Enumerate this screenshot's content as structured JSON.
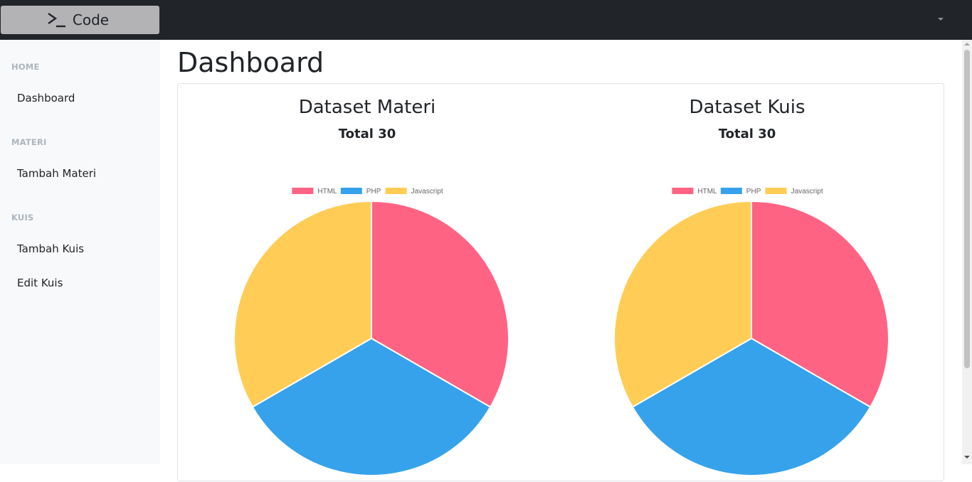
{
  "header": {
    "brand_label": "Code",
    "brand_icon": "terminal-icon"
  },
  "sidebar": {
    "sections": [
      {
        "heading": "HOME",
        "items": [
          {
            "label": "Dashboard"
          }
        ]
      },
      {
        "heading": "MATERI",
        "items": [
          {
            "label": "Tambah Materi"
          }
        ]
      },
      {
        "heading": "KUIS",
        "items": [
          {
            "label": "Tambah Kuis"
          },
          {
            "label": "Edit Kuis"
          }
        ]
      }
    ]
  },
  "main": {
    "page_title": "Dashboard"
  },
  "colors": {
    "html": "#ff6384",
    "php": "#36a2eb",
    "javascript": "#ffcd56",
    "topbar": "#212529",
    "sidebar": "#f8f9fa"
  },
  "charts": [
    {
      "title": "Dataset Materi",
      "subtitle": "Total 30"
    },
    {
      "title": "Dataset Kuis",
      "subtitle": "Total 30"
    }
  ],
  "chart_data": [
    {
      "type": "pie",
      "title": "Dataset Materi",
      "subtitle": "Total 30",
      "categories": [
        "HTML",
        "PHP",
        "Javascript"
      ],
      "values": [
        10,
        10,
        10
      ],
      "colors": [
        "#ff6384",
        "#36a2eb",
        "#ffcd56"
      ],
      "legend_position": "top"
    },
    {
      "type": "pie",
      "title": "Dataset Kuis",
      "subtitle": "Total 30",
      "categories": [
        "HTML",
        "PHP",
        "Javascript"
      ],
      "values": [
        10,
        10,
        10
      ],
      "colors": [
        "#ff6384",
        "#36a2eb",
        "#ffcd56"
      ],
      "legend_position": "top"
    }
  ]
}
